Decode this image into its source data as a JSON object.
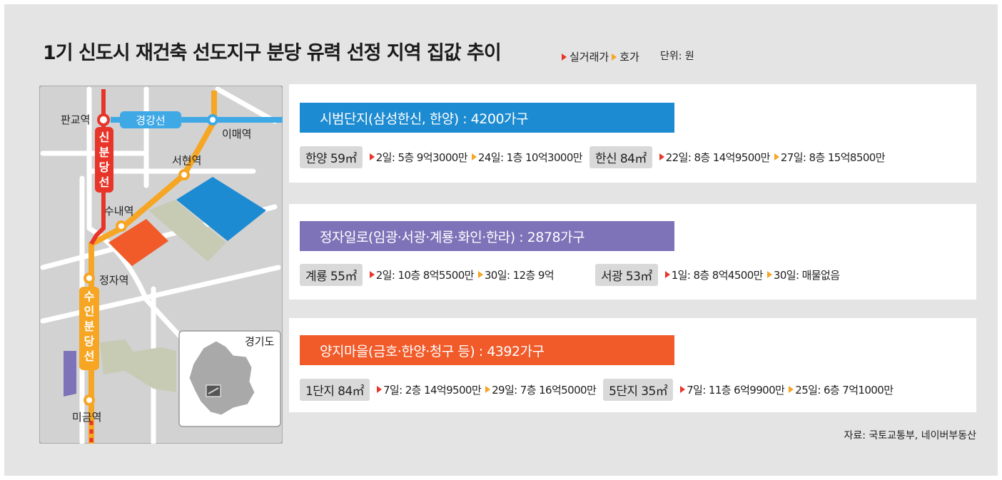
{
  "title": "1기 신도시 재건축 선도지구 분당 유력 선정 지역 집값 추이",
  "legend": {
    "actual": "실거래가",
    "asking": "호가",
    "unit": "단위: 원"
  },
  "colors": {
    "blue": "#1d8bd1",
    "purple": "#7e72b8",
    "orange": "#f15a29",
    "red_line": "#e8352a",
    "yellow_line": "#f6a623",
    "gyeonggang": "#3fa9e6",
    "green_area": "#c7cbb4"
  },
  "map": {
    "station_pangyo": "판교역",
    "line_gyeonggang": "경강선",
    "station_imae": "이매역",
    "line_sinbundang": "신분당선",
    "station_seohyeon": "서현역",
    "station_sunae": "수내역",
    "station_jeongja": "정자역",
    "line_suin_bundang": "수인분당선",
    "station_migeum": "미금역",
    "inset_label": "경기도"
  },
  "sections": [
    {
      "title": "시범단지(삼성한신, 한양) : 4200가구",
      "groups": [
        {
          "chip": "한양 59㎡",
          "items": [
            "2일: 5층 9억3000만",
            "24일: 1층 10억3000만"
          ]
        },
        {
          "chip": "한신 84㎡",
          "items": [
            "22일: 8층 14억9500만",
            "27일: 8층 15억8500만"
          ]
        }
      ]
    },
    {
      "title": "정자일로(임광·서광·계룡·화인·한라) : 2878가구",
      "groups": [
        {
          "chip": "계룡 55㎡",
          "items": [
            "2일: 10층 8억5500만",
            "30일: 12층 9억"
          ]
        },
        {
          "chip": "서광 53㎡",
          "items": [
            "1일: 8층 8억4500만",
            "30일: 매물없음"
          ]
        }
      ]
    },
    {
      "title": "양지마을(금호·한양·청구 등) : 4392가구",
      "groups": [
        {
          "chip": "1단지 84㎡",
          "items": [
            "7일: 2층 14억9500만",
            "29일: 7층 16억5000만"
          ]
        },
        {
          "chip": "5단지 35㎡",
          "items": [
            "7일: 11층 6억9900만",
            "25일: 6층 7억1000만"
          ]
        }
      ]
    }
  ],
  "source": "자료: 국토교통부, 네이버부동산"
}
